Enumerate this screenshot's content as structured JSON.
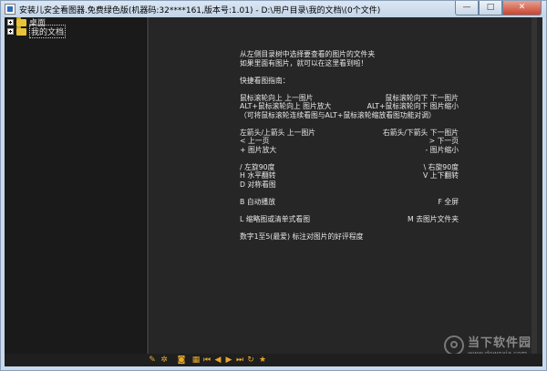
{
  "window": {
    "title": "安装儿安全看图器.免费绿色版(机器码:32****161,版本号:1.01) - D:\\用户目录\\我的文档\\(0个文件)",
    "buttons": {
      "minimize": "—",
      "maximize": "□",
      "close": "✕"
    }
  },
  "tree": {
    "items": [
      {
        "label": "桌面",
        "icon": "folder-icon",
        "selected": false
      },
      {
        "label": "我的文档",
        "icon": "folder-icon",
        "selected": true
      }
    ]
  },
  "help": {
    "intro1": "从左侧目录树中选择要查看的图片的文件夹",
    "intro2": "如果里面有图片，就可以在这里看到啦！",
    "quick_title": "快捷看图指南：",
    "wheel_up": "鼠标滚轮向上 上一图片",
    "wheel_down": "鼠标滚轮向下 下一图片",
    "alt_up": "ALT+鼠标滚轮向上 图片放大",
    "alt_down": "ALT+鼠标滚轮向下 图片缩小",
    "alt_note": "（可将鼠标滚轮连续看图与ALT+鼠标滚轮缩放看图功能对调）",
    "left_up": "左箭头/上箭头 上一图片",
    "right_down": "右箭头/下箭头 下一图片",
    "prev_page": "<  上一页",
    "next_page": ">  下一页",
    "zoom_in": "+  图片放大",
    "zoom_out": "-  图片缩小",
    "rot_left": "/  左旋90度",
    "rot_right": "\\  右旋90度",
    "flip_h": "H  水平翻转",
    "flip_v": "V  上下翻转",
    "sym": "D  对称看图",
    "autoplay": "B  自动播放",
    "fullscreen": "F  全屏",
    "thumb": "L  缩略图或清单式看图",
    "goto_folder": "M  去图片文件夹",
    "rating": "数字1至5(最爱) 标注对图片的好评程度"
  },
  "toolbar": {
    "buttons": [
      {
        "name": "edit-icon",
        "glyph": "✎"
      },
      {
        "name": "settings-gear-icon",
        "glyph": "✲"
      },
      {
        "name": "info-icon",
        "glyph": "◙"
      },
      {
        "name": "grid-view-icon",
        "glyph": "▦"
      },
      {
        "name": "first-icon",
        "glyph": "⏮"
      },
      {
        "name": "prev-icon",
        "glyph": "◀"
      },
      {
        "name": "next-icon",
        "glyph": "▶"
      },
      {
        "name": "last-icon",
        "glyph": "⏭"
      },
      {
        "name": "rotate-icon",
        "glyph": "↻"
      },
      {
        "name": "star-icon",
        "glyph": "★"
      }
    ]
  },
  "watermark": {
    "title": "当下软件园",
    "url": "www.downxia.com"
  },
  "colors": {
    "background": "#262626",
    "text": "#e8e8e8",
    "accent": "#e6a72a",
    "folder": "#e8c33a"
  }
}
